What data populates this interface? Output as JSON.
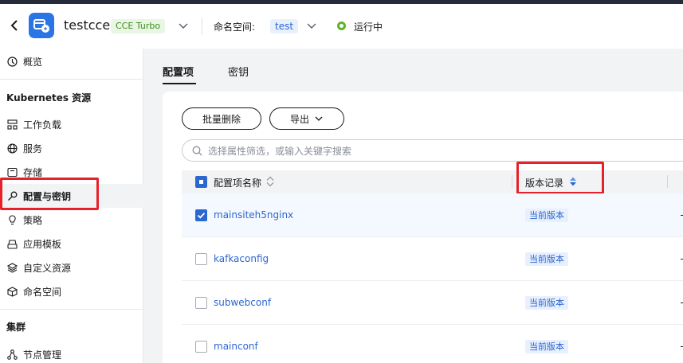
{
  "header": {
    "cluster_name": "testcce",
    "cluster_type": "CCE Turbo",
    "namespace_label": "命名空间:",
    "namespace_value": "test",
    "status": "运行中"
  },
  "sidebar": {
    "overview": "概览",
    "section_k8s": "Kubernetes 资源",
    "items": [
      {
        "label": "工作负载",
        "icon": "workload-icon"
      },
      {
        "label": "服务",
        "icon": "globe-icon"
      },
      {
        "label": "存储",
        "icon": "storage-icon"
      },
      {
        "label": "配置与密钥",
        "icon": "key-icon"
      },
      {
        "label": "策略",
        "icon": "bulb-icon"
      },
      {
        "label": "应用模板",
        "icon": "template-icon"
      },
      {
        "label": "自定义资源",
        "icon": "layers-icon"
      },
      {
        "label": "命名空间",
        "icon": "cube-icon"
      }
    ],
    "section_cluster": "集群",
    "node_mgmt": "节点管理"
  },
  "tabs": {
    "configmaps": "配置项",
    "secrets": "密钥"
  },
  "toolbar": {
    "batch_delete": "批量删除",
    "export": "导出"
  },
  "search": {
    "placeholder": "选择属性筛选，或输入关键字搜索"
  },
  "table": {
    "col_name": "配置项名称",
    "col_version": "版本记录",
    "rows": [
      {
        "name": "mainsiteh5nginx",
        "version": "当前版本",
        "checked": true
      },
      {
        "name": "kafkaconfig",
        "version": "当前版本",
        "checked": false
      },
      {
        "name": "subwebconf",
        "version": "当前版本",
        "checked": false
      },
      {
        "name": "mainconf",
        "version": "当前版本",
        "checked": false
      }
    ]
  },
  "colors": {
    "accent": "#2c66d1",
    "highlight": "#e8202a",
    "running": "#5fb32b"
  }
}
